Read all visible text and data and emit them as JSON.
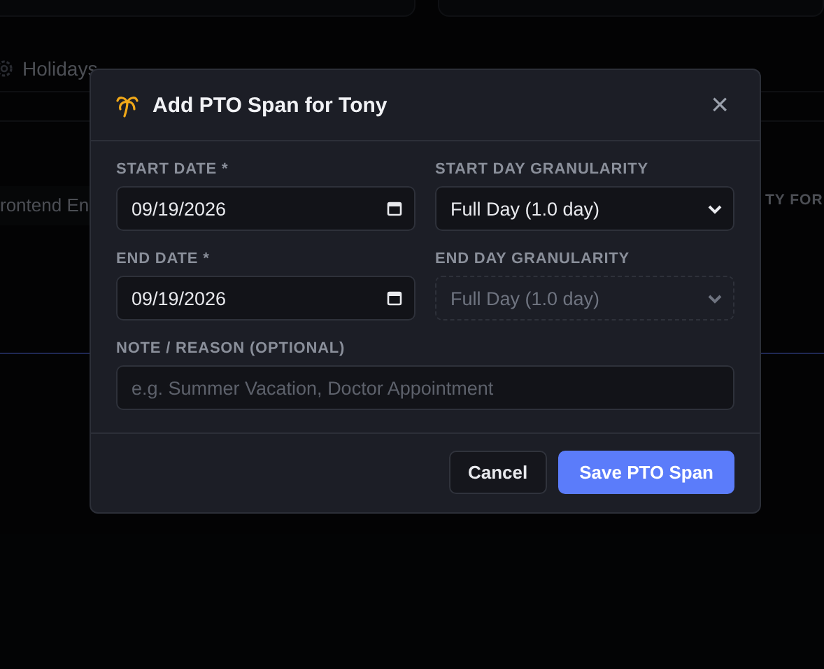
{
  "background": {
    "section_title": "Holidays",
    "cell_fragment": "rontend En",
    "column_fragment": "TY FOR"
  },
  "dialog": {
    "title": "Add PTO Span for Tony",
    "close": "×",
    "rows": [
      {
        "fields": [
          {
            "kind": "date",
            "label": "START DATE *",
            "value": "09/19/2026",
            "disabled": false
          },
          {
            "kind": "select",
            "label": "START DAY GRANULARITY",
            "value": "Full Day (1.0 day)",
            "disabled": false
          }
        ]
      },
      {
        "fields": [
          {
            "kind": "date",
            "label": "END DATE *",
            "value": "09/19/2026",
            "disabled": false
          },
          {
            "kind": "select",
            "label": "END DAY GRANULARITY",
            "value": "Full Day (1.0 day)",
            "disabled": true
          }
        ]
      },
      {
        "fields": [
          {
            "kind": "text",
            "label": "NOTE / REASON (OPTIONAL)",
            "placeholder": "e.g. Summer Vacation, Doctor Appointment",
            "disabled": false
          }
        ]
      }
    ],
    "buttons": [
      {
        "label": "Cancel",
        "kind": "secondary"
      },
      {
        "label": "Save PTO Span",
        "kind": "primary"
      }
    ]
  }
}
